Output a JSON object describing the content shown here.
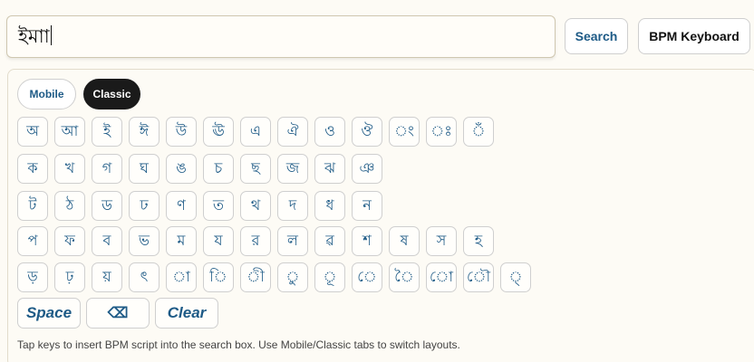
{
  "search": {
    "value": "ইমাা"
  },
  "buttons": {
    "search": "Search",
    "bpm_keyboard": "BPM Keyboard"
  },
  "tabs": {
    "mobile": "Mobile",
    "classic": "Classic",
    "active": "Classic"
  },
  "keyboard": {
    "rows": [
      [
        "অ",
        "আ",
        "ই",
        "ঈ",
        "উ",
        "ঊ",
        "এ",
        "ঐ",
        "ও",
        "ঔ",
        "ং",
        "ঃ",
        "ঁ"
      ],
      [
        "ক",
        "খ",
        "গ",
        "ঘ",
        "ঙ",
        "চ",
        "ছ",
        "জ",
        "ঝ",
        "ঞ"
      ],
      [
        "ট",
        "ঠ",
        "ড",
        "ঢ",
        "ণ",
        "ত",
        "থ",
        "দ",
        "ধ",
        "ন"
      ],
      [
        "প",
        "ফ",
        "ব",
        "ভ",
        "ম",
        "য",
        "র",
        "ল",
        "ৱ",
        "শ",
        "ষ",
        "স",
        "হ"
      ],
      [
        "ড়",
        "ঢ়",
        "য়",
        "ৎ",
        "া",
        "ি",
        "ী",
        "ু",
        "ূ",
        "ে",
        "ৈ",
        "ো",
        "ৌ",
        "্"
      ]
    ],
    "space_label": "Space",
    "backspace_label": "⌫",
    "clear_label": "Clear"
  },
  "hint": "Tap keys to insert BPM script into the search box. Use Mobile/Classic tabs to switch layouts.",
  "colors": {
    "accent": "#1d5a86",
    "active_tab": "#1a1a1a",
    "background": "#fdfbf5"
  }
}
